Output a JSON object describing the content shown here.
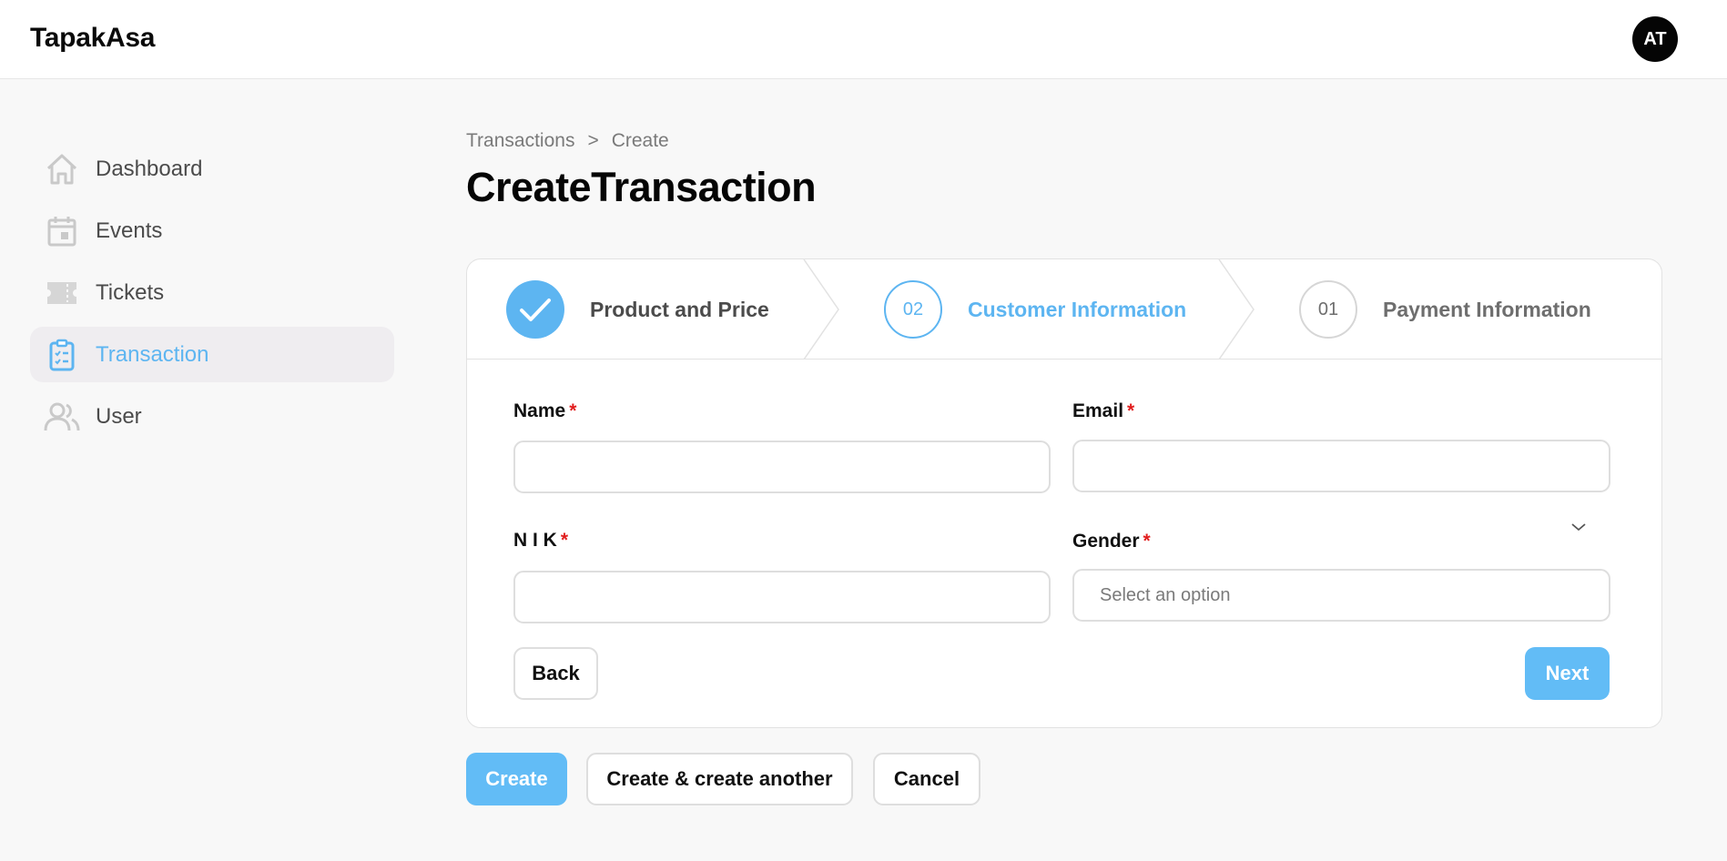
{
  "header": {
    "brand": "TapakAsa",
    "avatar_initials": "AT"
  },
  "sidebar": {
    "items": [
      {
        "label": "Dashboard",
        "icon": "home-icon",
        "active": false
      },
      {
        "label": "Events",
        "icon": "calendar-icon",
        "active": false
      },
      {
        "label": "Tickets",
        "icon": "ticket-icon",
        "active": false
      },
      {
        "label": "Transaction",
        "icon": "clipboard-icon",
        "active": true
      },
      {
        "label": "User",
        "icon": "users-icon",
        "active": false
      }
    ]
  },
  "breadcrumb": {
    "parent": "Transactions",
    "separator": ">",
    "current": "Create"
  },
  "page": {
    "title": "CreateTransaction"
  },
  "stepper": {
    "steps": [
      {
        "label": "Product and Price",
        "badge": "",
        "state": "completed"
      },
      {
        "label": "Customer Information",
        "badge": "02",
        "state": "current"
      },
      {
        "label": "Payment Information",
        "badge": "01",
        "state": "upcoming"
      }
    ]
  },
  "form": {
    "name": {
      "label": "Name",
      "required_mark": "*",
      "value": ""
    },
    "email": {
      "label": "Email",
      "required_mark": "*",
      "value": ""
    },
    "nik": {
      "label": "N I K",
      "required_mark": "*",
      "value": ""
    },
    "gender": {
      "label": "Gender",
      "required_mark": "*",
      "placeholder": "Select an option"
    },
    "back_label": "Back",
    "next_label": "Next"
  },
  "actions": {
    "create_label": "Create",
    "create_another_label": "Create & create another",
    "cancel_label": "Cancel"
  },
  "colors": {
    "accent": "#5db5f1",
    "primary_button": "#62bcf6",
    "required": "#e11d1d",
    "active_nav_bg": "#efedf0",
    "text_dark": "#0a0a0a"
  }
}
